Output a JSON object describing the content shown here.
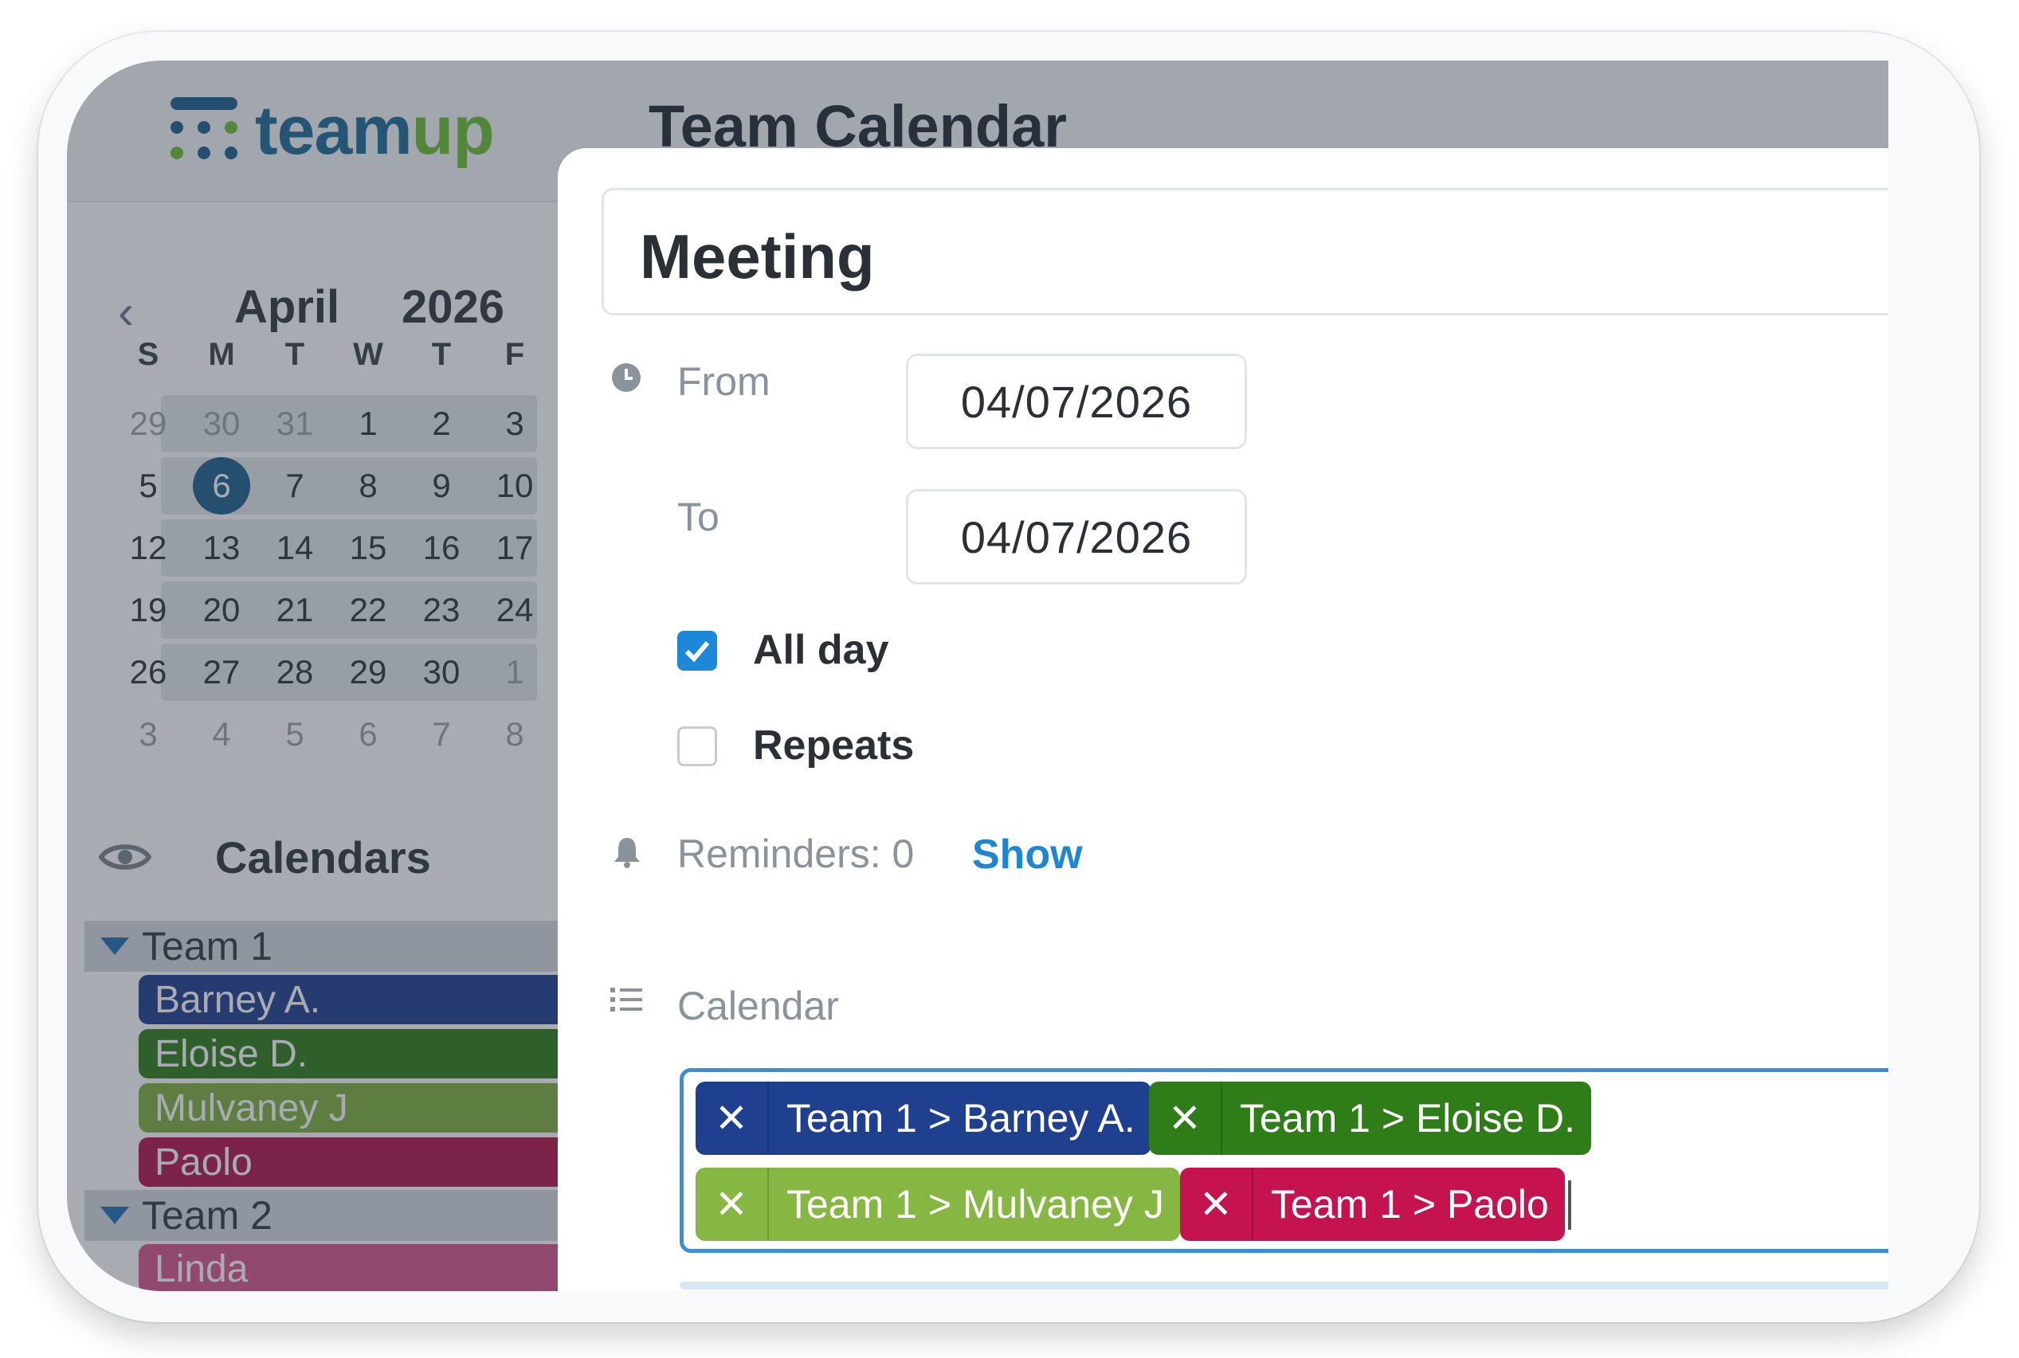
{
  "app": {
    "logo_text_1": "team",
    "logo_text_2": "up",
    "title": "Team Calendar"
  },
  "mini_calendar": {
    "month": "April",
    "year": "2026",
    "prev_icon": "chevron-left-icon",
    "weekday_headers": [
      "S",
      "M",
      "T",
      "W",
      "T",
      "F"
    ],
    "weeks": [
      [
        "29",
        "30",
        "31",
        "1",
        "2",
        "3"
      ],
      [
        "5",
        "6",
        "7",
        "8",
        "9",
        "10"
      ],
      [
        "12",
        "13",
        "14",
        "15",
        "16",
        "17"
      ],
      [
        "19",
        "20",
        "21",
        "22",
        "23",
        "24"
      ],
      [
        "26",
        "27",
        "28",
        "29",
        "30",
        "1"
      ],
      [
        "3",
        "4",
        "5",
        "6",
        "7",
        "8"
      ]
    ],
    "today": "6"
  },
  "calendars_panel": {
    "title": "Calendars",
    "eye_icon": "eye-icon",
    "groups": [
      {
        "name": "Team 1",
        "members": [
          {
            "name": "Barney A.",
            "color": "#1f3f8f"
          },
          {
            "name": "Eloise D.",
            "color": "#2f7d18"
          },
          {
            "name": "Mulvaney J",
            "color": "#7fb03c"
          },
          {
            "name": "Paolo",
            "color": "#b4144a"
          }
        ]
      },
      {
        "name": "Team 2",
        "members": [
          {
            "name": "Linda",
            "color": "#d9558c"
          }
        ]
      }
    ]
  },
  "event_form": {
    "title": "Meeting",
    "from_label": "From",
    "from_value": "04/07/2026",
    "to_label": "To",
    "to_value": "04/07/2026",
    "all_day_label": "All day",
    "all_day_checked": true,
    "repeats_label": "Repeats",
    "repeats_checked": false,
    "reminders_label": "Reminders: 0",
    "reminders_link": "Show",
    "calendar_label": "Calendar",
    "selected_calendars": [
      {
        "label": "Team 1 > Barney A.",
        "color": "#1f3f8f"
      },
      {
        "label": "Team 1 > Eloise D.",
        "color": "#2f7d18"
      },
      {
        "label": "Team 1 > Mulvaney J",
        "color": "#86b743"
      },
      {
        "label": "Team 1 > Paolo",
        "color": "#c4134f"
      }
    ]
  },
  "colors": {
    "accent": "#1f86d2",
    "brand_blue": "#1e6a94",
    "brand_green": "#6cbf2f"
  }
}
